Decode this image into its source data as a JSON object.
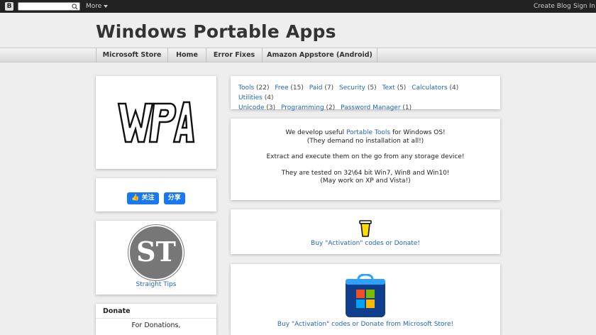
{
  "navbar": {
    "logo_letter": "B",
    "more_label": "More",
    "create_blog_label": "Create Blog",
    "sign_in_label": "Sign In"
  },
  "header": {
    "title": "Windows Portable Apps"
  },
  "tabs": [
    {
      "label": "Microsoft Store"
    },
    {
      "label": "Home"
    },
    {
      "label": "Error Fixes"
    },
    {
      "label": "Amazon Appstore (Android)"
    }
  ],
  "sidebar": {
    "follow_label": "关注",
    "share_label": "分享",
    "st_logo_text": "ST",
    "straight_tips_label": "Straight Tips",
    "donate_title": "Donate",
    "donate_text": "For Donations,"
  },
  "labels": [
    {
      "name": "Tools",
      "count": "(22)"
    },
    {
      "name": "Free",
      "count": "(15)"
    },
    {
      "name": "Paid",
      "count": "(7)"
    },
    {
      "name": "Security",
      "count": "(5)"
    },
    {
      "name": "Text",
      "count": "(5)"
    },
    {
      "name": "Calculators",
      "count": "(4)"
    },
    {
      "name": "Utilities",
      "count": "(4)"
    },
    {
      "name": "Unicode",
      "count": "(3)"
    },
    {
      "name": "Programming",
      "count": "(2)"
    },
    {
      "name": "Password Manager",
      "count": "(1)"
    }
  ],
  "intro": {
    "line1_pre": "We develop useful ",
    "line1_link": "Portable Tools",
    "line1_post": " for Windows OS!",
    "line2": "(They demand no installation at all!)",
    "line3": "Extract and execute them on the go from any storage device!",
    "line4": "They are tested on 32\\64 bit Win7, Win8 and Win10!",
    "line5": "(May work on XP and Vista!)"
  },
  "donate_card": {
    "link": "Buy \"Activation\" codes or Donate!"
  },
  "store_card": {
    "link": "Buy \"Activation\" codes or Donate from Microsoft Store!"
  },
  "colors": {
    "navbar_bg": "#222222",
    "link": "#2266bb",
    "facebook_blue": "#1877f2",
    "page_bg": "#eeeeee"
  }
}
